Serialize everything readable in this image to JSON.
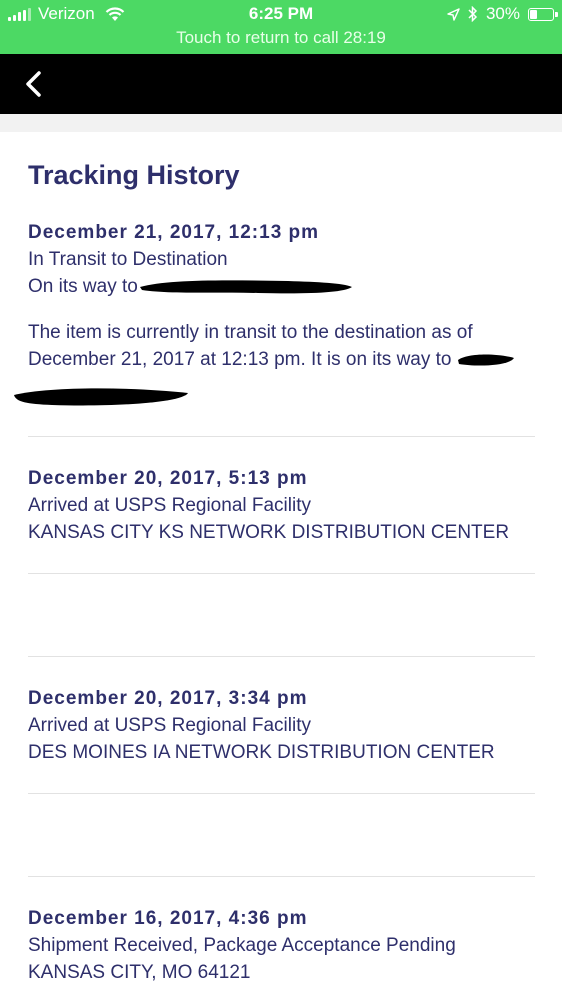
{
  "status_bar": {
    "carrier": "Verizon",
    "time": "6:25 PM",
    "battery_percent": "30%",
    "call_banner": "Touch to return to call 28:19"
  },
  "header": {
    "back_icon": "chevron-left-icon"
  },
  "page": {
    "title": "Tracking History"
  },
  "tracking_events": [
    {
      "date": "December 21, 2017, 12:13 pm",
      "status": "In Transit to Destination",
      "location": "On its way to",
      "description": "The item is currently in transit to the destination as of December 21, 2017 at 12:13 pm. It is on its way to"
    },
    {
      "date": "December 20, 2017, 5:13 pm",
      "status": "Arrived at USPS Regional Facility",
      "location": "KANSAS CITY KS NETWORK DISTRIBUTION CENTER"
    },
    {
      "date": "December 20, 2017, 3:34 pm",
      "status": "Arrived at USPS Regional Facility",
      "location": "DES MOINES IA NETWORK DISTRIBUTION CENTER"
    },
    {
      "date": "December 16, 2017, 4:36 pm",
      "status": "Shipment Received, Package Acceptance Pending",
      "location": "KANSAS CITY, MO 64121"
    }
  ],
  "colors": {
    "status_green": "#4cd964",
    "nav_black": "#000000",
    "text_navy": "#2e2f6b",
    "divider": "#e2e2e2"
  }
}
